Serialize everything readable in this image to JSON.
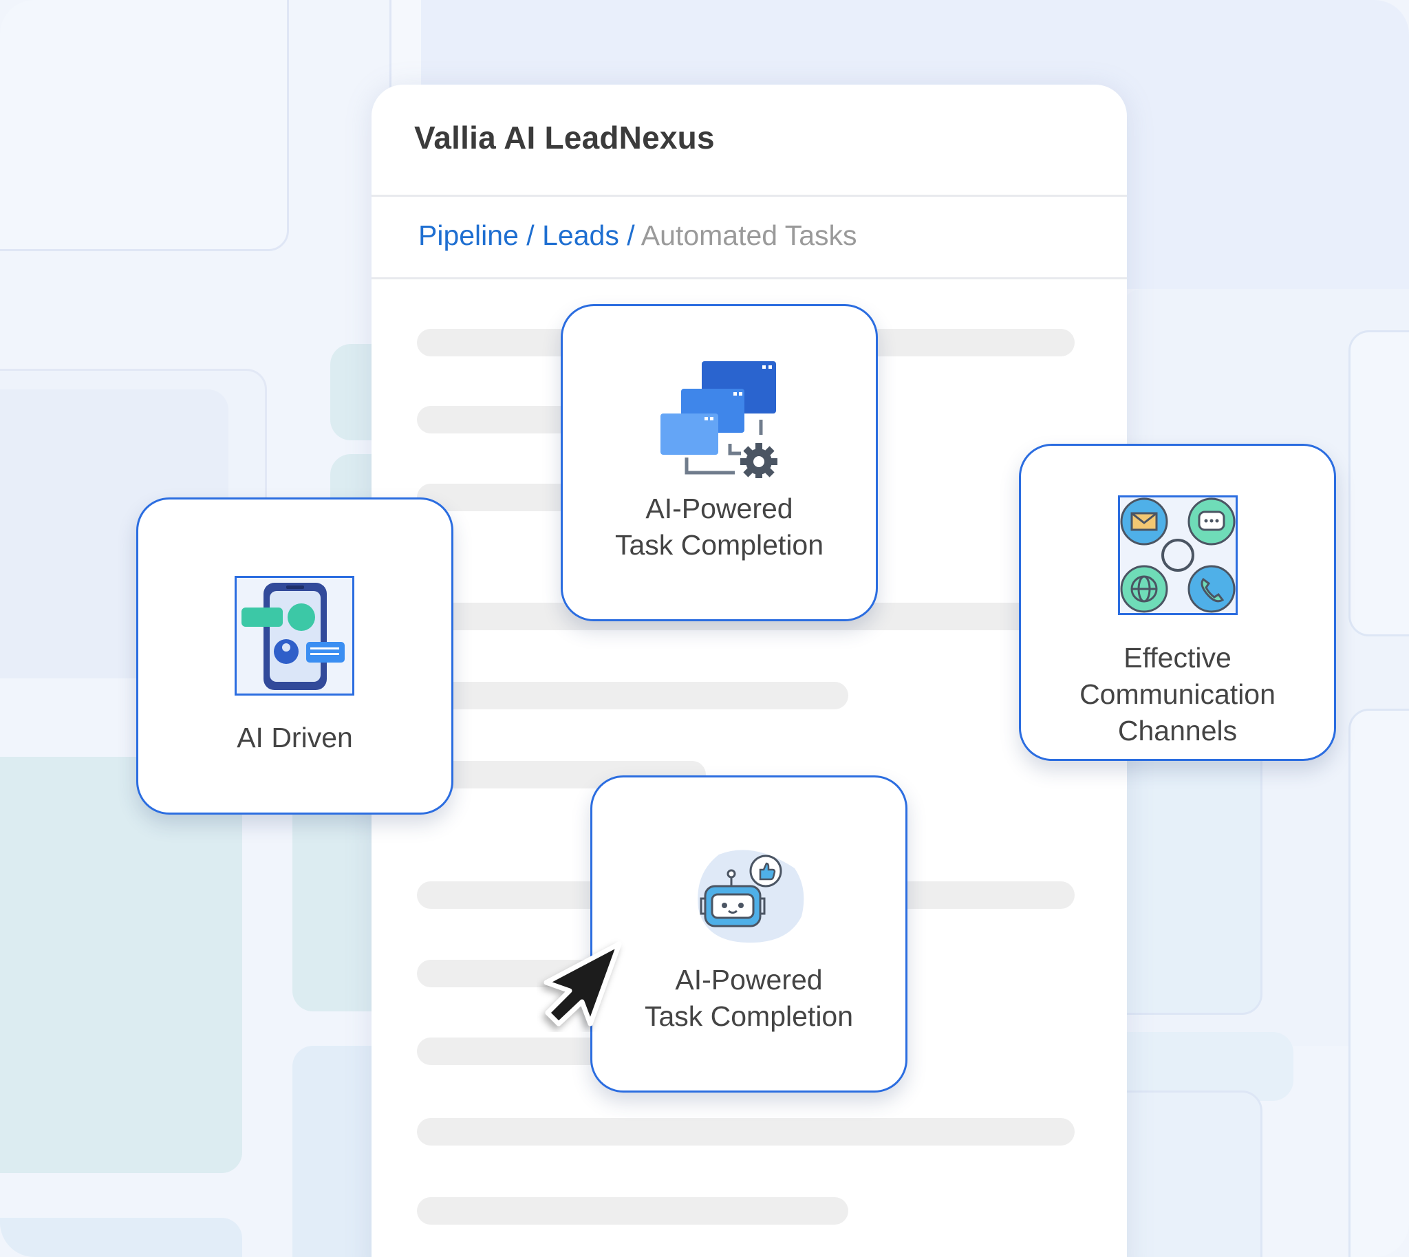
{
  "app": {
    "title": "Vallia AI LeadNexus"
  },
  "breadcrumb": {
    "items": [
      "Pipeline",
      "Leads"
    ],
    "separator": "/",
    "current": "Automated Tasks"
  },
  "cards": {
    "top": {
      "label": "AI-Powered\nTask Completion",
      "icon": "windows-gear-icon"
    },
    "left": {
      "label": "AI Driven",
      "icon": "phone-chat-icon"
    },
    "right": {
      "label": "Effective\nCommunication\nChannels",
      "icon": "communication-channels-icon"
    },
    "bottom": {
      "label": "AI-Powered\nTask Completion",
      "icon": "robot-thumbs-up-icon"
    }
  },
  "colors": {
    "accent": "#2b6de0",
    "link": "#1f6fd1",
    "muted_text": "#9a9a9a",
    "skeleton": "#eeeeee",
    "background": "#f1f5fc"
  }
}
